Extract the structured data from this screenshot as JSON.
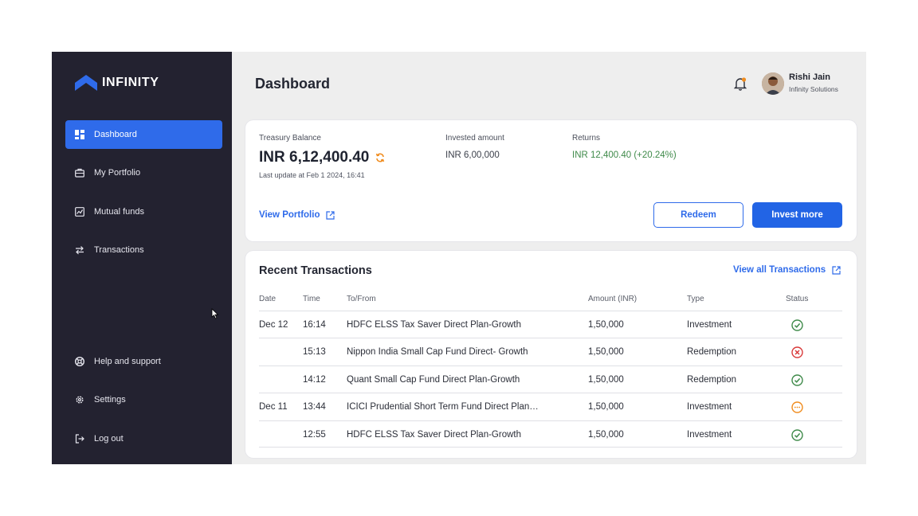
{
  "brand": {
    "name": "INFINITY"
  },
  "sidebar": {
    "items": [
      {
        "label": "Dashboard",
        "icon": "dashboard-icon",
        "active": true
      },
      {
        "label": "My Portfolio",
        "icon": "briefcase-icon",
        "active": false
      },
      {
        "label": "Mutual funds",
        "icon": "chart-icon",
        "active": false
      },
      {
        "label": "Transactions",
        "icon": "transfer-icon",
        "active": false
      }
    ],
    "bottom_items": [
      {
        "label": "Help and support",
        "icon": "lifebuoy-icon"
      },
      {
        "label": "Settings",
        "icon": "gear-icon"
      },
      {
        "label": "Log out",
        "icon": "logout-icon"
      }
    ]
  },
  "header": {
    "title": "Dashboard",
    "user": {
      "name": "Rishi Jain",
      "org": "Infinity Solutions"
    }
  },
  "summary": {
    "balance_label": "Treasury Balance",
    "balance_value": "INR 6,12,400.40",
    "last_update": "Last update at Feb 1 2024, 16:41",
    "invested_label": "Invested amount",
    "invested_value": "INR 6,00,000",
    "returns_label": "Returns",
    "returns_value": "INR 12,400.40 (+20.24%)",
    "view_portfolio": "View Portfolio",
    "redeem": "Redeem",
    "invest_more": "Invest more"
  },
  "transactions": {
    "title": "Recent Transactions",
    "view_all": "View all Transactions",
    "columns": [
      "Date",
      "Time",
      "To/From",
      "Amount (INR)",
      "Type",
      "Status"
    ],
    "rows": [
      {
        "date": "Dec 12",
        "time": "16:14",
        "fund": "HDFC ELSS Tax Saver Direct Plan-Growth",
        "amount": "1,50,000",
        "type": "Investment",
        "status": "success"
      },
      {
        "date": "",
        "time": "15:13",
        "fund": "Nippon India Small Cap Fund Direct- Growth",
        "amount": "1,50,000",
        "type": "Redemption",
        "status": "failed"
      },
      {
        "date": "",
        "time": "14:12",
        "fund": "Quant Small Cap Fund Direct Plan-Growth",
        "amount": "1,50,000",
        "type": "Redemption",
        "status": "success"
      },
      {
        "date": "Dec 11",
        "time": "13:44",
        "fund": "ICICI Prudential Short Term Fund Direct Plan…",
        "amount": "1,50,000",
        "type": "Investment",
        "status": "pending"
      },
      {
        "date": "",
        "time": "12:55",
        "fund": "HDFC ELSS Tax Saver Direct Plan-Growth",
        "amount": "1,50,000",
        "type": "Investment",
        "status": "success"
      }
    ]
  },
  "colors": {
    "sidebar": "#232230",
    "accent": "#2f6bea",
    "success": "#3f8a4a",
    "failed": "#d93a3a",
    "pending": "#f08c1e"
  }
}
